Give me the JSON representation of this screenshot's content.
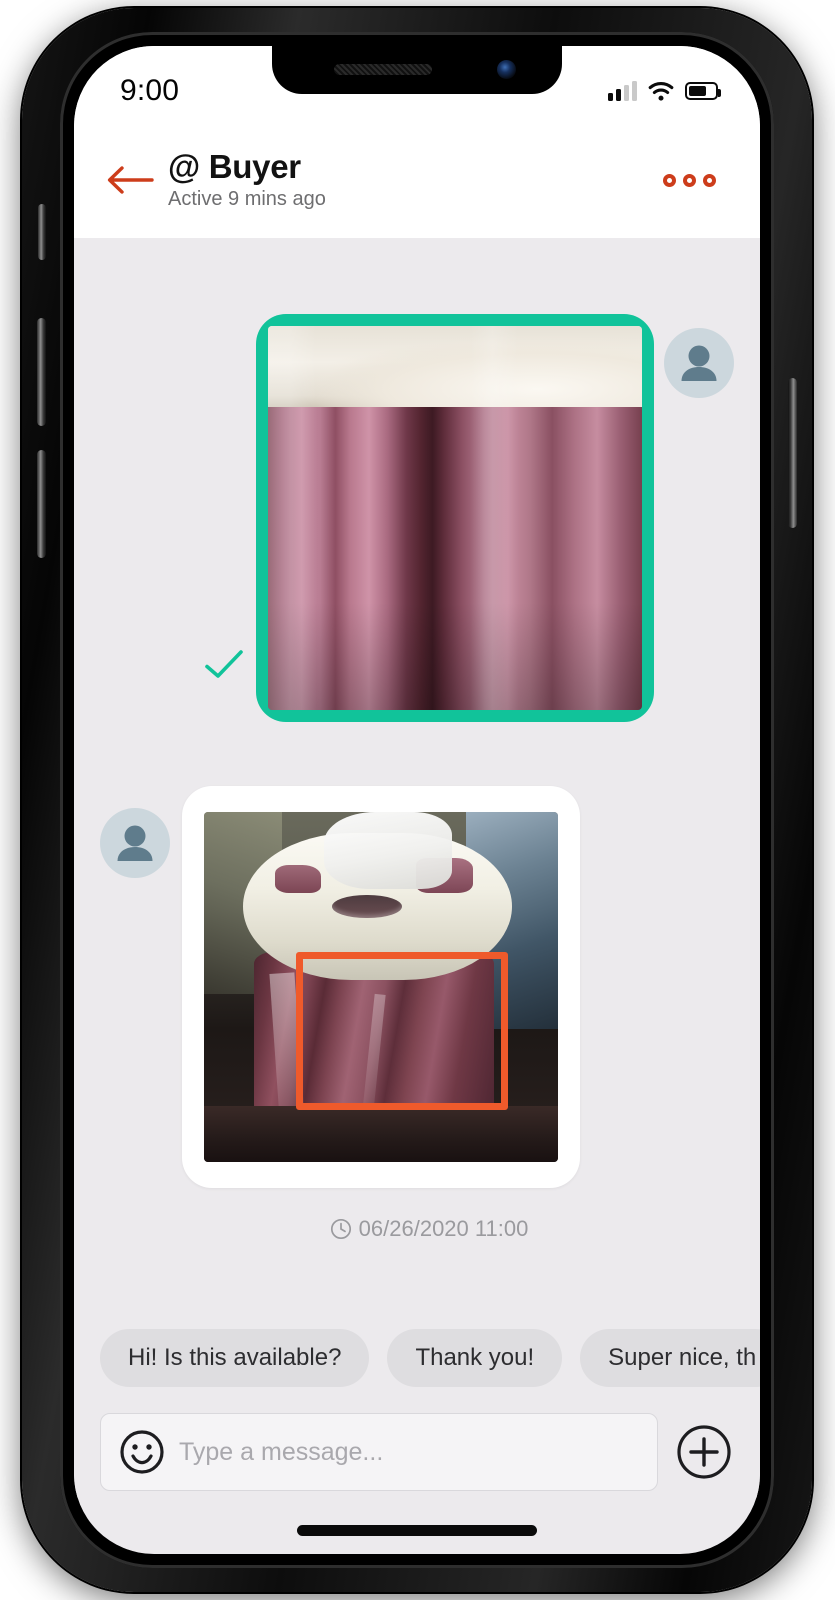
{
  "status_bar": {
    "time": "9:00",
    "signal_icon": "signal-bars-icon",
    "signal_bars_filled": 2,
    "signal_bars_total": 4,
    "wifi_icon": "wifi-icon",
    "battery_icon": "battery-icon",
    "battery_level_percent": 58
  },
  "header": {
    "back_icon": "back-arrow-icon",
    "contact_name": "@ Buyer",
    "status_text": "Active 9 mins ago",
    "more_icon": "more-options-icon"
  },
  "messages": [
    {
      "direction": "outgoing",
      "type": "image",
      "image_name": "pink-foil-roll-closeup-photo",
      "bubble_color": "#11c39a",
      "avatar_icon": "person-avatar-icon",
      "delivered_icon": "delivered-check-icon"
    },
    {
      "direction": "incoming",
      "type": "image",
      "image_name": "foil-roll-in-white-tub-photo",
      "bubble_color": "#ffffff",
      "avatar_icon": "person-avatar-icon",
      "annotation": {
        "name": "orange-bounding-box",
        "color": "#ef5a2b"
      }
    }
  ],
  "timestamp": {
    "clock_icon": "clock-icon",
    "text": "06/26/2020 11:00"
  },
  "quick_replies": [
    {
      "label": "Hi! Is this available?"
    },
    {
      "label": "Thank you!"
    },
    {
      "label": "Super nice, th"
    }
  ],
  "composer": {
    "emoji_icon": "smiley-icon",
    "input_value": "",
    "input_placeholder": "Type a message...",
    "add_icon": "plus-circle-icon"
  },
  "colors": {
    "accent_green": "#11c39a",
    "accent_orange": "#ef5a2b",
    "header_accent": "#cd3d1b",
    "chat_background": "#eceaed",
    "chip_background": "#dedde0"
  },
  "device": {
    "home_indicator": "home-indicator",
    "notch_speaker": "speaker-grille",
    "notch_camera": "front-camera"
  }
}
